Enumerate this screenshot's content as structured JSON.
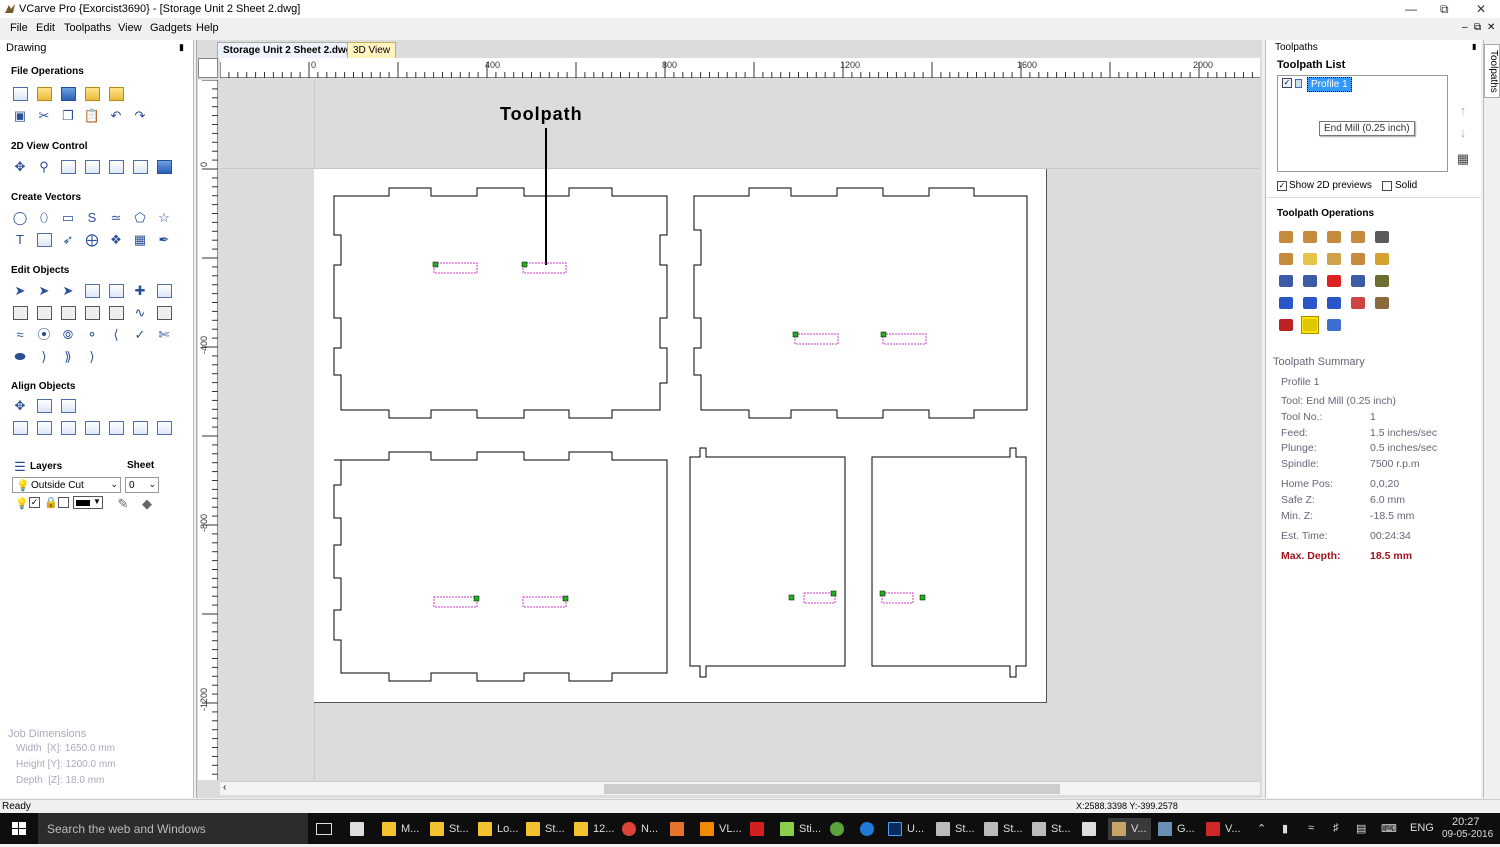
{
  "window": {
    "title": "VCarve Pro {Exorcist3690} - [Storage Unit 2 Sheet 2.dwg]"
  },
  "menu": [
    "File",
    "Edit",
    "Toolpaths",
    "View",
    "Gadgets",
    "Help"
  ],
  "left_panel": {
    "title": "Drawing",
    "sections": {
      "file_ops": "File Operations",
      "view2d": "2D View Control",
      "create_vectors": "Create Vectors",
      "edit_objects": "Edit Objects",
      "align_objects": "Align Objects"
    },
    "layers": {
      "label": "Layers",
      "sheet_label": "Sheet",
      "layer_value": "Outside Cut",
      "sheet_value": "0"
    },
    "job_dimensions": {
      "title": "Job Dimensions",
      "width": "Width  [X]: 1650.0 mm",
      "height": "Height [Y]: 1200.0 mm",
      "depth": "Depth  [Z]: 18.0 mm"
    }
  },
  "tabs": {
    "drawing": "Storage Unit 2 Sheet 2.dwg",
    "view3d": "3D View"
  },
  "ruler": {
    "h_labels": [
      "0",
      "400",
      "800",
      "1200",
      "1600",
      "2000"
    ],
    "v_labels": [
      "0",
      "-400",
      "-800",
      "-1200"
    ]
  },
  "canvas": {
    "annotation": "Toolpath"
  },
  "status": {
    "left": "Ready",
    "coords": "X:2588.3398 Y:-399.2578"
  },
  "right_panel": {
    "title": "Toolpaths",
    "list_title": "Toolpath List",
    "toolpath_name": "Profile 1",
    "tooltip": "End Mill (0.25 inch)",
    "show_2d": "Show 2D previews",
    "solid": "Solid",
    "ops_title": "Toolpath Operations",
    "summary": {
      "title": "Toolpath Summary",
      "name": "Profile 1",
      "tool": "Tool: End Mill (0.25 inch)",
      "rows": [
        {
          "label": "Tool No.:",
          "value": "1"
        },
        {
          "label": "Feed:",
          "value": "1.5 inches/sec"
        },
        {
          "label": "Plunge:",
          "value": "0.5 inches/sec"
        },
        {
          "label": "Spindle:",
          "value": "7500 r.p.m"
        },
        {
          "label": "Home Pos:",
          "value": "0,0,20"
        },
        {
          "label": "Safe Z:",
          "value": "6.0 mm"
        },
        {
          "label": "Min. Z:",
          "value": "-18.5 mm"
        },
        {
          "label": "Est. Time:",
          "value": "00:24:34"
        },
        {
          "label": "Max. Depth:",
          "value": "18.5 mm"
        }
      ]
    },
    "side_tab": "Toolpaths"
  },
  "taskbar": {
    "search": "Search the web and Windows",
    "items": [
      "M...",
      "St...",
      "Lo...",
      "St...",
      "12...",
      "N...",
      "VL...",
      "Sti...",
      "U...",
      "St...",
      "St...",
      "St...",
      "V...",
      "G...",
      "V..."
    ],
    "lang": "ENG",
    "time": "20:27",
    "date": "09-05-2016"
  }
}
